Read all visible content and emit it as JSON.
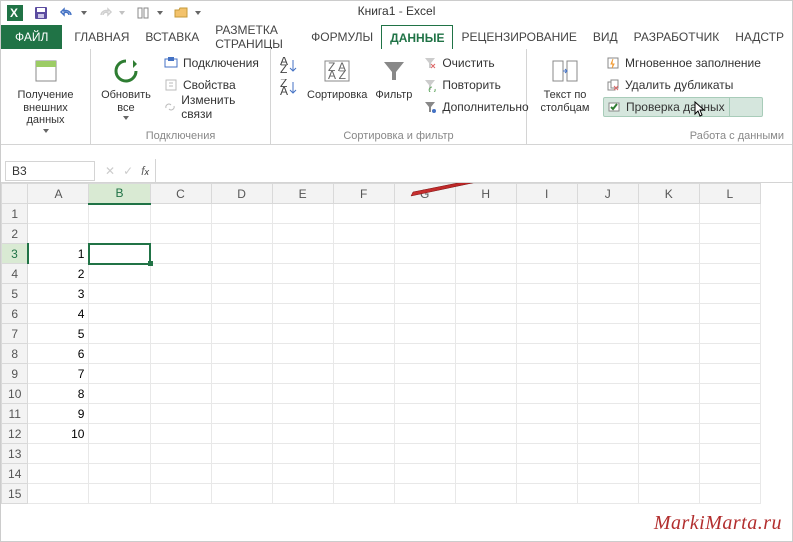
{
  "title_doc": "Книга1",
  "title_app": "Excel",
  "tabs": {
    "file": "ФАЙЛ",
    "home": "ГЛАВНАЯ",
    "insert": "ВСТАВКА",
    "layout": "РАЗМЕТКА СТРАНИЦЫ",
    "formulas": "ФОРМУЛЫ",
    "data": "ДАННЫЕ",
    "review": "РЕЦЕНЗИРОВАНИЕ",
    "view": "ВИД",
    "developer": "РАЗРАБОТЧИК",
    "addin": "НАДСТР"
  },
  "ribbon": {
    "grp_ext": {
      "btn": "Получение\nвнешних данных",
      "label": ""
    },
    "grp_conn": {
      "btn": "Обновить\nвсе",
      "conns": "Подключения",
      "props": "Свойства",
      "edit": "Изменить связи",
      "label": "Подключения"
    },
    "grp_sort": {
      "btn": "Сортировка",
      "label": "Сортировка и фильтр"
    },
    "grp_filter": {
      "btn": "Фильтр",
      "clear": "Очистить",
      "reapply": "Повторить",
      "adv": "Дополнительно"
    },
    "grp_tools": {
      "btn": "Текст по\nстолбцам",
      "flash": "Мгновенное заполнение",
      "dup": "Удалить дубликаты",
      "valid": "Проверка данных",
      "label": "Работа с данными"
    }
  },
  "namebox": "B3",
  "columns": [
    "A",
    "B",
    "C",
    "D",
    "E",
    "F",
    "G",
    "H",
    "I",
    "J",
    "K",
    "L"
  ],
  "rows": [
    1,
    2,
    3,
    4,
    5,
    6,
    7,
    8,
    9,
    10,
    11,
    12,
    13,
    14,
    15
  ],
  "cells": {
    "A3": "1",
    "A4": "2",
    "A5": "3",
    "A6": "4",
    "A7": "5",
    "A8": "6",
    "A9": "7",
    "A10": "8",
    "A11": "9",
    "A12": "10"
  },
  "selected": "B3",
  "watermark": "MarkiMarta.ru"
}
